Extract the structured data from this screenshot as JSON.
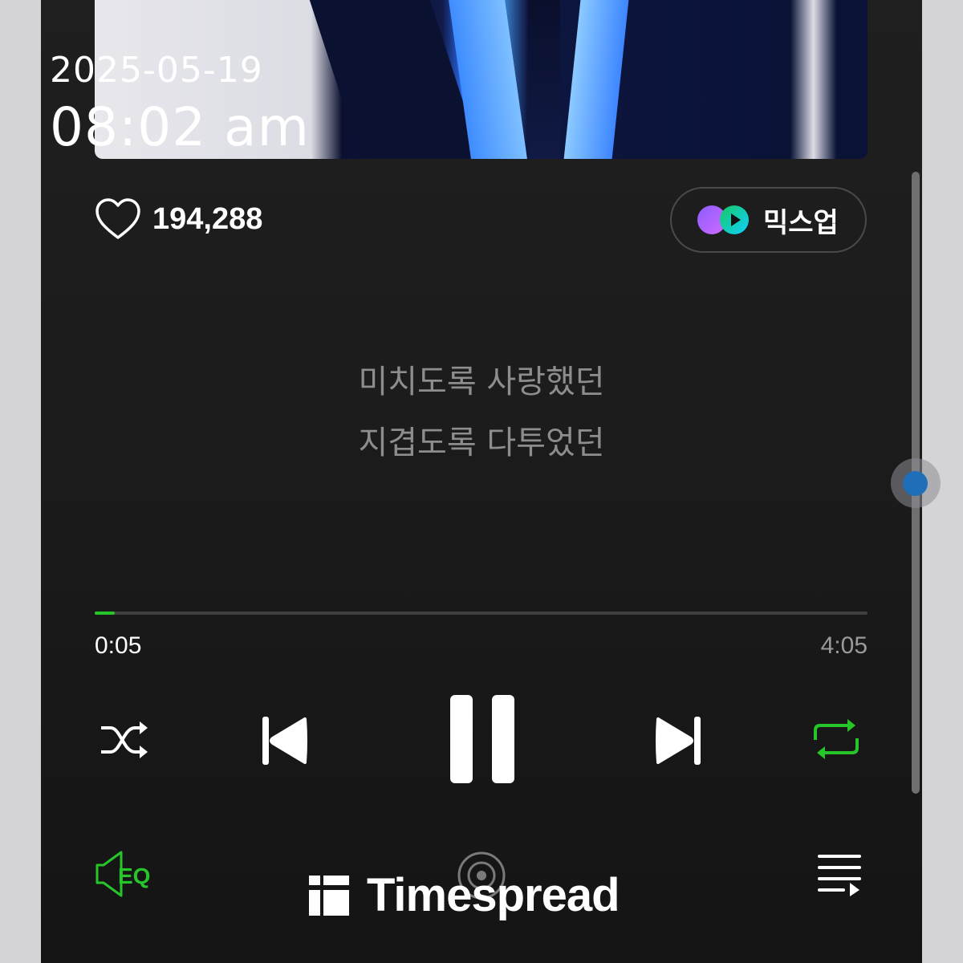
{
  "overlay": {
    "date": "2025-05-19",
    "time": "08:02 am"
  },
  "track": {
    "like_count": "194,288"
  },
  "mixup": {
    "label": "믹스업"
  },
  "lyrics": [
    "미치도록 사랑했던",
    "지겹도록 다투었던"
  ],
  "progress": {
    "elapsed": "0:05",
    "total": "4:05",
    "fraction": 0.026
  },
  "controls": {
    "shuffle_icon": "shuffle-icon",
    "previous_icon": "skip-previous-icon",
    "pause_icon": "pause-icon",
    "next_icon": "skip-next-icon",
    "repeat_icon": "repeat-icon",
    "repeat_active": true,
    "eq_label": "EQ",
    "eq_icon": "equalizer-icon",
    "cast_icon": "cast-icon",
    "playlist_icon": "playlist-icon"
  },
  "watermark": {
    "text": "Timespread"
  },
  "colors": {
    "accent": "#26c52a",
    "background": "#1b1b1b",
    "lyrics": "#8d8d8d",
    "scroll_handle": "#1f6fb8"
  }
}
